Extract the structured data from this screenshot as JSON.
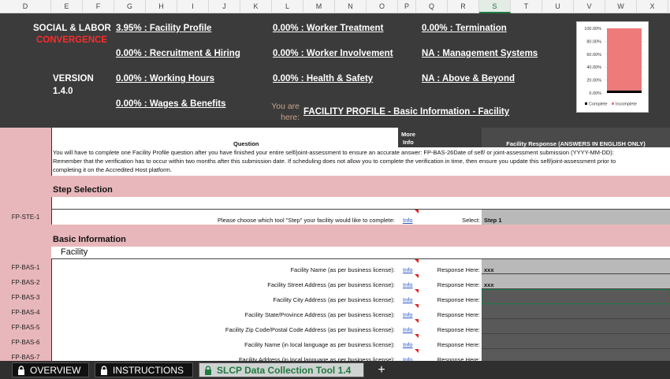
{
  "columns": [
    "D",
    "E",
    "F",
    "G",
    "H",
    "I",
    "J",
    "K",
    "L",
    "M",
    "N",
    "O",
    "P",
    "Q",
    "R",
    "S",
    "T",
    "U",
    "V",
    "W",
    "X"
  ],
  "selected_column": "S",
  "header": {
    "brand_line1": "SOCIAL & LABOR",
    "brand_line2": "CONVERGENCE",
    "version_label": "VERSION",
    "version_number": "1.4.0",
    "progress_links": {
      "facility_profile": "3.95% : Facility Profile",
      "recruitment_hiring": "0.00% : Recruitment & Hiring",
      "working_hours": "0.00% : Working Hours",
      "wages_benefits": "0.00% : Wages & Benefits",
      "worker_treatment": "0.00% : Worker Treatment",
      "worker_involvement": "0.00% : Worker Involvement",
      "health_safety": "0.00% : Health & Safety",
      "termination": "0.00% : Termination",
      "management_systems": "NA : Management Systems",
      "above_beyond": "NA : Above & Beyond"
    },
    "you_are_here_line1": "You are",
    "you_are_here_line2": "here:",
    "location": "FACILITY PROFILE - Basic Information - Facility"
  },
  "chart_data": {
    "type": "bar",
    "y_ticks": [
      "100.00%",
      "80.00%",
      "60.00%",
      "40.00%",
      "20.00%",
      "0.00%"
    ],
    "ylim": [
      0,
      100
    ],
    "series": [
      {
        "name": "Complete",
        "values": [
          3.95
        ],
        "color": "#000000"
      },
      {
        "name": "Incomplete",
        "values": [
          96.05
        ],
        "color": "#ee7a7a"
      }
    ],
    "stacked": true,
    "legend": "bottom"
  },
  "table": {
    "question_header": "Question",
    "more_info_header": "More Info",
    "response_header": "Facility Response (ANSWERS IN ENGLISH ONLY)",
    "intro_line1": "You will have to complete one Facility Profile question after you have finished your entire self/joint-assessment to ensure an accurate answer: FP-BAS-26Date of self/ or joint-assessment submission (YYYY-MM-DD):",
    "intro_line2": "Remember that the verification has to occur within two months after this submission date. If scheduling does not allow you to complete the verification in time, then ensure you update this self/joint-assessment prior to",
    "intro_line3": "completing it on the Accredited Host platform.",
    "step_section": "Step Selection",
    "step_row": {
      "id": "FP-STE-1",
      "question": "Please choose which tool \"Step\" your facility would like to complete:",
      "info": "Info",
      "select_label": "Select:",
      "value": "Step 1"
    },
    "basic_section": "Basic Information",
    "facility_subsection": "Facility",
    "response_label": "Response Here:",
    "rows": [
      {
        "id": "FP-BAS-1",
        "question": "Facility Name (as per business license):",
        "info": "Info",
        "value": "xxx"
      },
      {
        "id": "FP-BAS-2",
        "question": "Facility Street Address (as per business license):",
        "info": "Info",
        "value": "xxx"
      },
      {
        "id": "FP-BAS-3",
        "question": "Facility City Address (as per business license):",
        "info": "Info",
        "value": ""
      },
      {
        "id": "FP-BAS-4",
        "question": "Facility State/Province Address (as per business license):",
        "info": "Info",
        "value": ""
      },
      {
        "id": "FP-BAS-5",
        "question": "Facility Zip Code/Postal Code Address (as per business license):",
        "info": "Info",
        "value": ""
      },
      {
        "id": "FP-BAS-6",
        "question": "Facility Name (in local language as per business license):",
        "info": "Info",
        "value": ""
      },
      {
        "id": "FP-BAS-7",
        "question": "Facility Address (in local language as per business license):",
        "info": "Info",
        "value": ""
      }
    ]
  },
  "tabs": {
    "overview": "OVERVIEW",
    "instructions": "INSTRUCTIONS",
    "tool": "SLCP Data Collection Tool 1.4",
    "add": "+"
  }
}
